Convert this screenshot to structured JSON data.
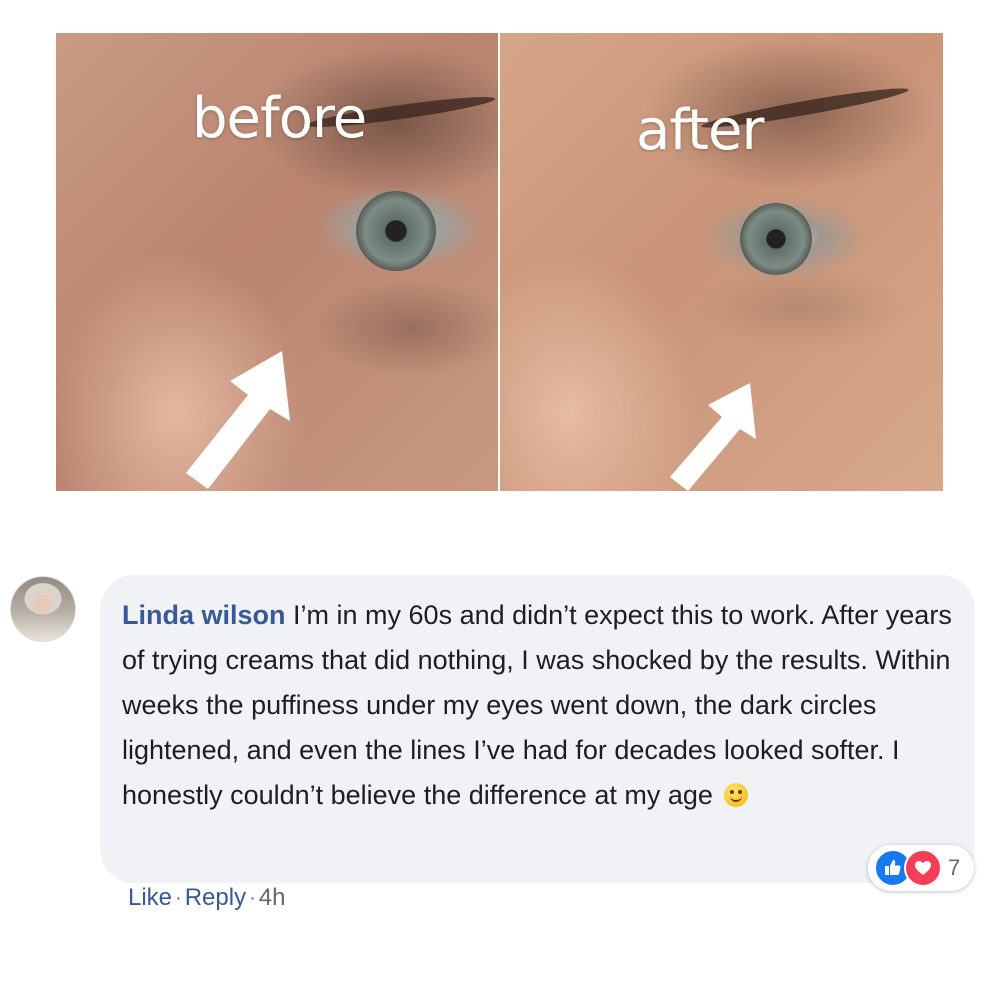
{
  "photos": {
    "before_label": "before",
    "after_label": "after"
  },
  "comment": {
    "author": "Linda wilson",
    "text": "I’m in my 60s and didn’t expect this to work. After years of trying creams that did nothing, I was shocked by the results. Within weeks the puffiness under my eyes went down, the dark circles lightened, and even the lines I’ve had for decades looked softer. I honestly couldn’t believe the difference at my age",
    "emoji": "smiling-face-emoji",
    "reaction_count": "7",
    "reaction_icons": [
      "like-icon",
      "love-icon"
    ],
    "actions": {
      "like": "Like",
      "separator": "·",
      "reply": "Reply",
      "time": "4h"
    }
  },
  "colors": {
    "author_link": "#385898",
    "bubble_bg": "#f0f2f5",
    "like_blue": "#1877f2",
    "love_red": "#f33e58",
    "meta_gray": "#65676b"
  }
}
